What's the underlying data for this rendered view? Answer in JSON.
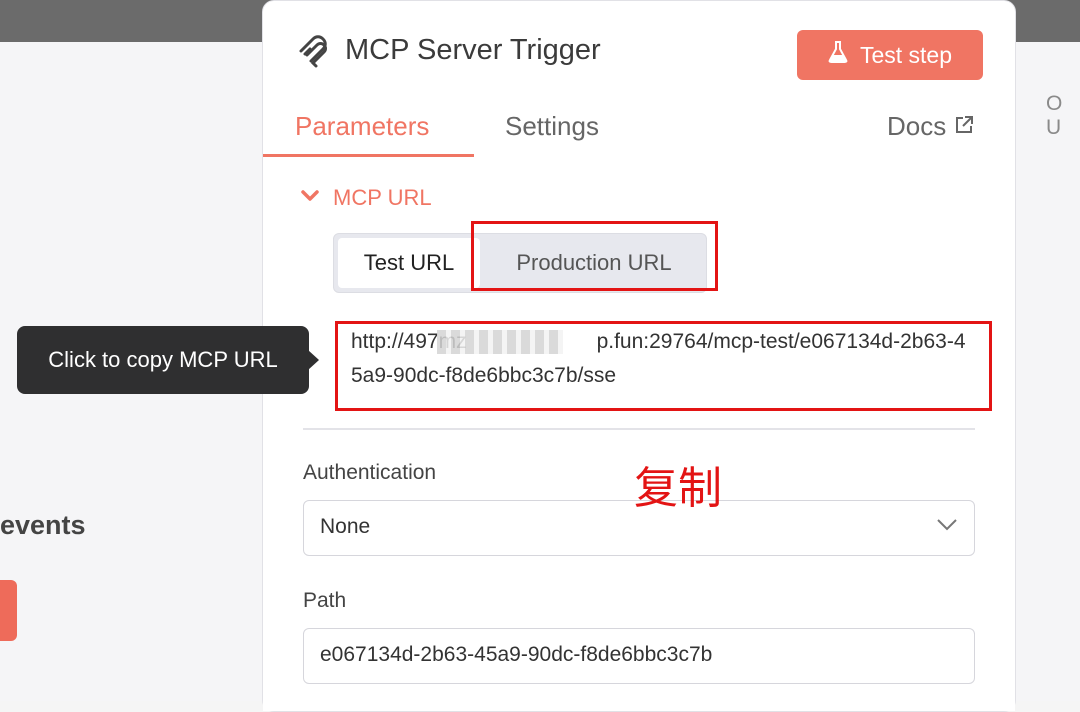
{
  "background": {
    "right_label": "O U",
    "events_text": "events"
  },
  "panel": {
    "title": "MCP Server Trigger",
    "test_step_label": "Test step",
    "tabs": [
      {
        "label": "Parameters",
        "active": true
      },
      {
        "label": "Settings",
        "active": false
      }
    ],
    "docs_label": "Docs",
    "section": {
      "label": "MCP URL",
      "expanded": true,
      "url_toggle": {
        "options": [
          "Test URL",
          "Production URL"
        ],
        "selected": "Test URL"
      },
      "url_visible_part1": "http://497mz",
      "url_visible_part2": "p.fun:29764/mcp-test/e067134d-2b63-45a9-90dc-f8de6bbc3c7b/sse",
      "tooltip": "Click to copy MCP URL"
    },
    "fields": {
      "authentication": {
        "label": "Authentication",
        "value": "None"
      },
      "path": {
        "label": "Path",
        "value": "e067134d-2b63-45a9-90dc-f8de6bbc3c7b"
      }
    }
  },
  "annotation": {
    "text": "复制",
    "color": "#e31414"
  },
  "colors": {
    "accent": "#f07563",
    "tooltip_bg": "#2f2f30"
  },
  "icons": {
    "node": "mcp-logo-icon",
    "test_step": "flask-icon",
    "docs": "external-link-icon",
    "section": "chevron-down-icon",
    "select": "chevron-down-icon"
  }
}
